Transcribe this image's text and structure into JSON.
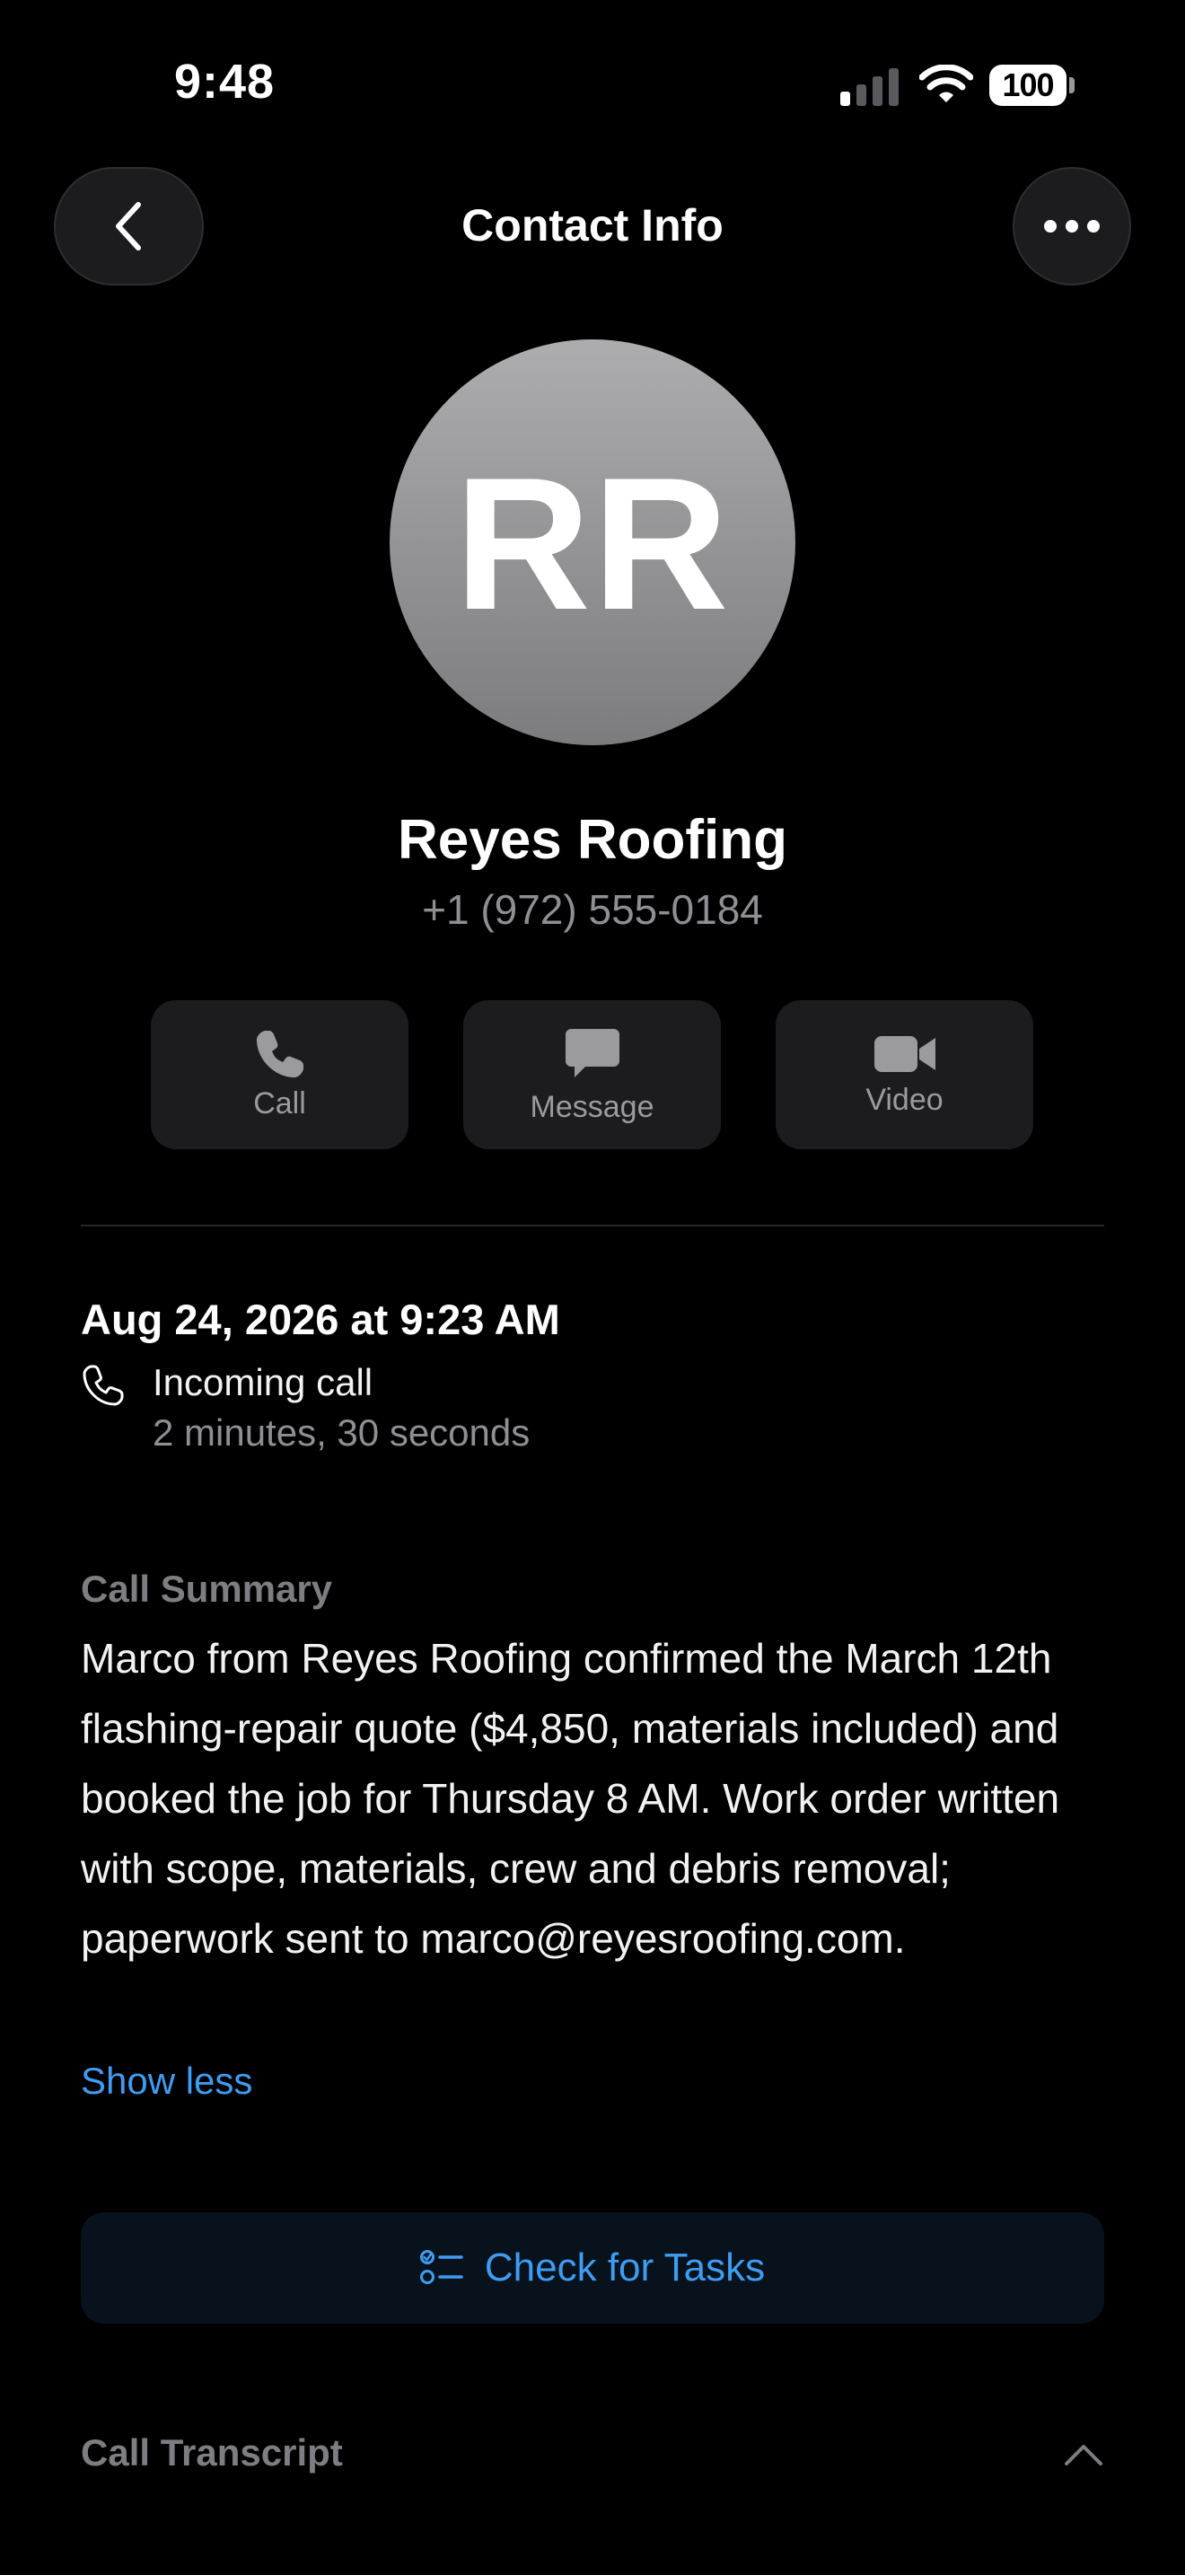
{
  "status_bar": {
    "time": "9:48",
    "battery": "100",
    "icons": [
      "cellular-signal-icon",
      "wifi-icon",
      "battery-icon"
    ]
  },
  "nav": {
    "title": "Contact Info",
    "back_icon": "chevron-left-icon",
    "more_icon": "ellipsis-icon"
  },
  "contact": {
    "initials": "RR",
    "name": "Reyes Roofing",
    "phone": "+1 (972) 555-0184"
  },
  "actions": [
    {
      "label": "Call",
      "icon": "phone-icon"
    },
    {
      "label": "Message",
      "icon": "message-bubble-icon"
    },
    {
      "label": "Video",
      "icon": "video-camera-icon"
    }
  ],
  "call": {
    "date": "Aug 24, 2026 at 9:23 AM",
    "type": "Incoming call",
    "duration": "2 minutes, 30 seconds"
  },
  "summary": {
    "heading": "Call Summary",
    "text": "Marco from Reyes Roofing confirmed the March 12th flashing-repair quote ($4,850, materials included) and booked the job for Thursday 8 AM. Work order written with scope, materials, crew and debris removal; paperwork sent to marco@reyesroofing.com.",
    "toggle": "Show less"
  },
  "tasks_button": {
    "label": "Check for Tasks",
    "icon": "checklist-icon"
  },
  "transcript": {
    "heading": "Call Transcript",
    "icon": "chevron-up-icon"
  },
  "colors": {
    "background": "#000000",
    "accent": "#3f9cf1",
    "secondary_text": "#8e8e93",
    "button_fill": "#1c1c1e"
  }
}
